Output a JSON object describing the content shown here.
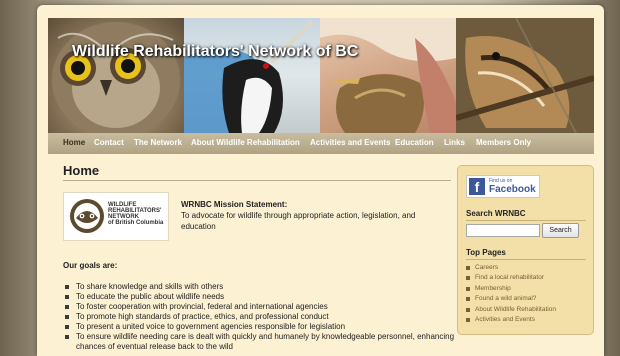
{
  "site_title": "Wildlife Rehabilitators' Network of BC",
  "nav": [
    {
      "label": "Home",
      "active": true
    },
    {
      "label": "Contact"
    },
    {
      "label": "The Network"
    },
    {
      "label": "About Wildlife Rehabilitation"
    },
    {
      "label": "Activities and Events"
    },
    {
      "label": "Education"
    },
    {
      "label": "Links"
    },
    {
      "label": "Members Only"
    }
  ],
  "page_title": "Home",
  "logo_text": "WILDLIFE\nREHABILITATORS'\nNETWORK\nof British Columbia",
  "mission": {
    "title": "WRNBC Mission Statement:",
    "text": "To advocate for wildlife through appropriate action, legislation, and education"
  },
  "goals": {
    "title": "Our goals are:",
    "items": [
      "To share knowledge and skills with others",
      "To educate the public about wildlife needs",
      "To foster cooperation with provincial, federal and international agencies",
      "To promote high standards of practice, ethics, and professional conduct",
      "To present a united voice to government agencies responsible for legislation",
      "To ensure wildlife needing care is dealt with quickly and humanely by knowledgeable personnel, enhancing chances of eventual release back to the wild"
    ]
  },
  "sidebar": {
    "facebook": {
      "find_us": "Find us on",
      "name": "Facebook"
    },
    "search_heading": "Search WRNBC",
    "search_placeholder": "",
    "search_button": "Search",
    "top_pages_heading": "Top Pages",
    "top_pages": [
      "Careers",
      "Find a local rehabilitator",
      "Membership",
      "Found a wild animal?",
      "About Wildlife Rehabilitation",
      "Activities and Events"
    ]
  },
  "colors": {
    "page_background": "#fdf1d4",
    "nav_bar": "#b0a283",
    "sidebar_panel": "#f3dfa8",
    "link_brown": "#7a5c37",
    "facebook_blue": "#3b5998"
  }
}
